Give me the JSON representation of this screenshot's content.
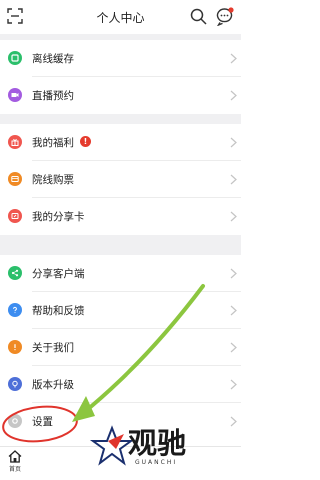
{
  "header": {
    "title": "个人中心",
    "left_icon": "scan-frame-icon",
    "search_icon": "search-icon",
    "message_icon": "message-bubble-icon"
  },
  "groups": [
    [
      {
        "label": "离线缓存",
        "icon": "download-icon",
        "color": "#2bbf6b"
      },
      {
        "label": "直播预约",
        "icon": "video-icon",
        "color": "#a35be0"
      }
    ],
    [
      {
        "label": "我的福利",
        "icon": "gift-icon",
        "color": "#f0564f",
        "badge": "!"
      },
      {
        "label": "院线购票",
        "icon": "ticket-icon",
        "color": "#f08a24"
      },
      {
        "label": "我的分享卡",
        "icon": "share-card-icon",
        "color": "#f0564f"
      }
    ],
    [
      {
        "label": "分享客户端",
        "icon": "share-icon",
        "color": "#2bbf6b"
      },
      {
        "label": "帮助和反馈",
        "icon": "help-icon",
        "color": "#3d8df0"
      },
      {
        "label": "关于我们",
        "icon": "info-icon",
        "color": "#f08a24"
      },
      {
        "label": "版本升级",
        "icon": "upgrade-icon",
        "color": "#4e6fd8"
      },
      {
        "label": "设置",
        "icon": "settings-icon",
        "color": "#b9b9b9"
      }
    ]
  ],
  "bottom_nav": {
    "home_label": "首页"
  },
  "watermark": {
    "brand": "观驰",
    "sub": "GUANCHI"
  },
  "annotation": {
    "highlight_color": "#e0342c",
    "arrow_color": "#8cc63f"
  }
}
